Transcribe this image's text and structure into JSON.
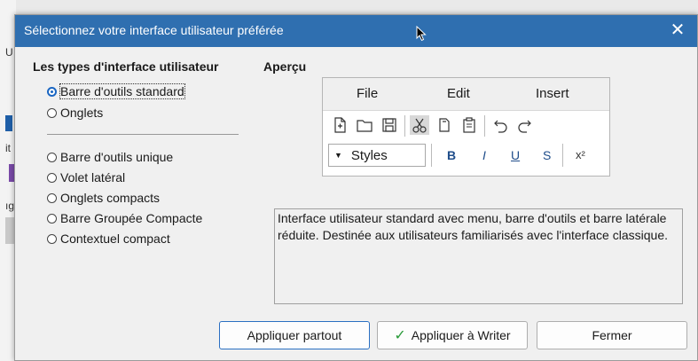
{
  "background": {
    "letters": [
      "U",
      "it",
      "ıg"
    ]
  },
  "dialog": {
    "title": "Sélectionnez votre interface utilisateur préférée",
    "close_symbol": "✕"
  },
  "left_panel": {
    "title": "Les types d'interface utilisateur",
    "group1": [
      {
        "label": "Barre d'outils standard",
        "checked": true
      },
      {
        "label": "Onglets",
        "checked": false
      }
    ],
    "group2": [
      {
        "label": "Barre d'outils unique",
        "checked": false
      },
      {
        "label": "Volet latéral",
        "checked": false
      },
      {
        "label": "Onglets compacts",
        "checked": false
      },
      {
        "label": "Barre Groupée Compacte",
        "checked": false
      },
      {
        "label": "Contextuel compact",
        "checked": false
      }
    ]
  },
  "preview": {
    "title": "Aperçu",
    "menu": [
      "File",
      "Edit",
      "Insert"
    ],
    "styles_label": "Styles",
    "format_buttons": [
      "B",
      "I",
      "U",
      "S",
      "x²"
    ],
    "toolbar_icons": [
      "new-document-icon",
      "open-folder-icon",
      "save-icon",
      "cut-icon",
      "copy-icon",
      "paste-icon",
      "undo-icon",
      "redo-icon"
    ]
  },
  "description": "Interface utilisateur standard avec menu, barre d'outils et barre latérale réduite. Destinée aux utilisateurs familiarisés avec l'interface classique.",
  "buttons": {
    "apply_all": "Appliquer partout",
    "apply_writer": "Appliquer à Writer",
    "close": "Fermer"
  },
  "colors": {
    "titlebar": "#2f6fb0",
    "accent": "#1a66c2",
    "check": "#2a9a3a"
  }
}
